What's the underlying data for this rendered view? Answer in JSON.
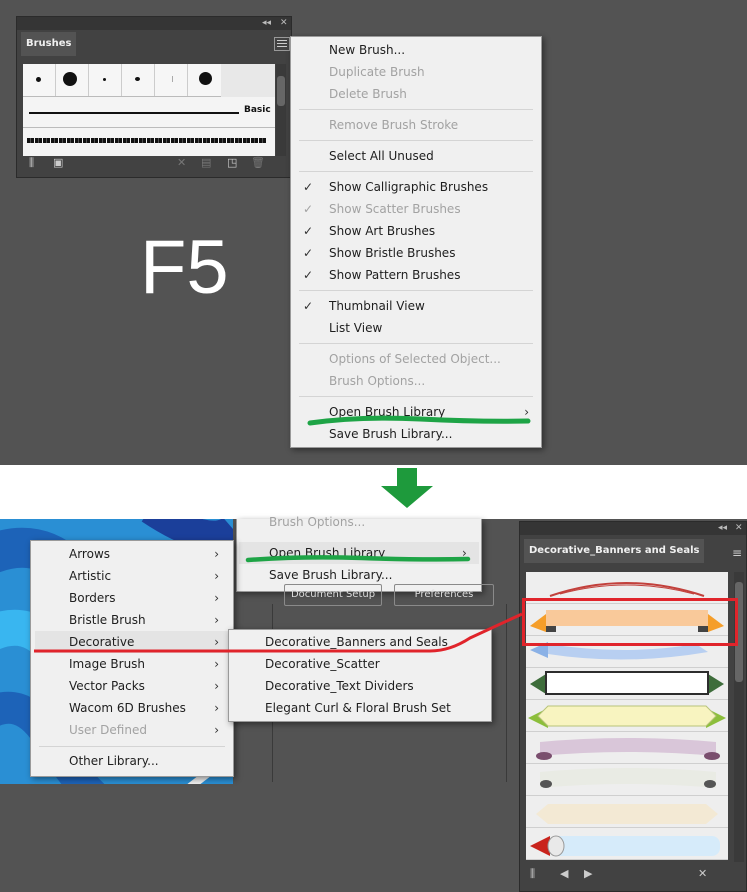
{
  "top": {
    "panel": {
      "tab": "Brushes",
      "controls": [
        "◂◂",
        "✕"
      ],
      "basic_label": "Basic"
    },
    "hotkey": "F5",
    "menu": {
      "items": [
        {
          "label": "New Brush...",
          "enabled": true
        },
        {
          "label": "Duplicate Brush",
          "enabled": false
        },
        {
          "label": "Delete Brush",
          "enabled": false
        },
        {
          "label": "Remove Brush Stroke",
          "enabled": false
        },
        {
          "label": "Select All Unused",
          "enabled": true
        },
        {
          "label": "Show Calligraphic Brushes",
          "enabled": true,
          "checked": true
        },
        {
          "label": "Show Scatter Brushes",
          "enabled": false,
          "checked": true
        },
        {
          "label": "Show Art Brushes",
          "enabled": true,
          "checked": true
        },
        {
          "label": "Show Bristle Brushes",
          "enabled": true,
          "checked": true
        },
        {
          "label": "Show Pattern Brushes",
          "enabled": true,
          "checked": true
        },
        {
          "label": "Thumbnail View",
          "enabled": true,
          "checked": true
        },
        {
          "label": "List View",
          "enabled": true
        },
        {
          "label": "Options of Selected Object...",
          "enabled": false
        },
        {
          "label": "Brush Options...",
          "enabled": false
        },
        {
          "label": "Open Brush Library",
          "enabled": true,
          "submenu": true
        },
        {
          "label": "Save Brush Library...",
          "enabled": true
        }
      ]
    }
  },
  "bottom": {
    "menu_fragment": {
      "brush_options": "Brush Options...",
      "open_library": "Open Brush Library",
      "save_library": "Save Brush Library...",
      "document_setup": "Document Setup",
      "preferences": "Preferences"
    },
    "library_menu": {
      "items": [
        "Arrows",
        "Artistic",
        "Borders",
        "Bristle Brush",
        "Decorative",
        "Image Brush",
        "Vector Packs",
        "Wacom 6D Brushes",
        "User Defined"
      ],
      "other": "Other Library...",
      "selected": "Decorative"
    },
    "decorative_submenu": {
      "items": [
        "Decorative_Banners and Seals",
        "Decorative_Scatter",
        "Decorative_Text Dividers",
        "Elegant Curl & Floral Brush Set"
      ]
    },
    "library_panel": {
      "tab": "Decorative_Banners and Seals",
      "controls": [
        "◂◂",
        "✕"
      ]
    }
  },
  "colors": {
    "highlight_green": "#1ea446",
    "highlight_red": "#e0242b",
    "arrow_green": "#1e9a3c",
    "ui_dark": "#535353"
  }
}
